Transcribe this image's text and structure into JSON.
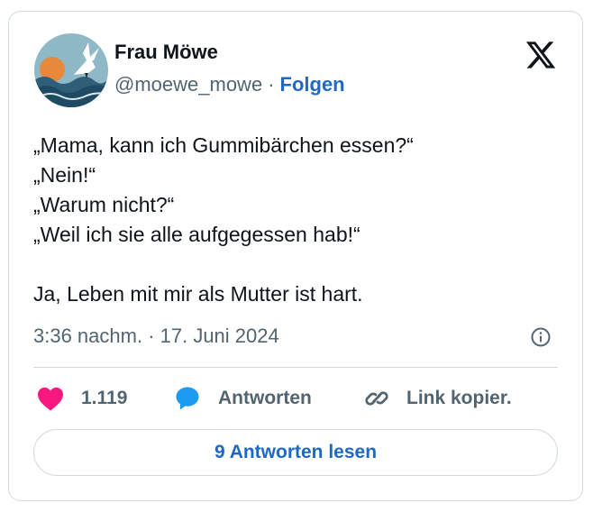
{
  "author": {
    "name": "Frau Möwe",
    "handle": "@moewe_mowe",
    "separator": "·",
    "follow_label": "Folgen"
  },
  "tweet": {
    "lines": [
      "„Mama, kann ich Gummibärchen essen?“",
      "„Nein!“",
      "„Warum nicht?“",
      "„Weil ich sie alle aufgegessen hab!“",
      "",
      "Ja, Leben mit mir als Mutter ist hart."
    ],
    "timestamp": "3:36 nachm. · 17. Juni 2024"
  },
  "actions": {
    "likes": "1.119",
    "reply_label": "Antworten",
    "copy_link_label": "Link kopier."
  },
  "read_replies_label": "9 Antworten lesen",
  "icons": {
    "logo": "x-logo-icon",
    "info": "info-icon",
    "like": "heart-icon",
    "reply": "speech-bubble-icon",
    "link": "link-icon"
  },
  "colors": {
    "accent": "#1d69c5",
    "heart": "#f91880",
    "reply_bubble": "#1d9bf0",
    "secondary_text": "#536471",
    "border": "#cfd9de"
  }
}
